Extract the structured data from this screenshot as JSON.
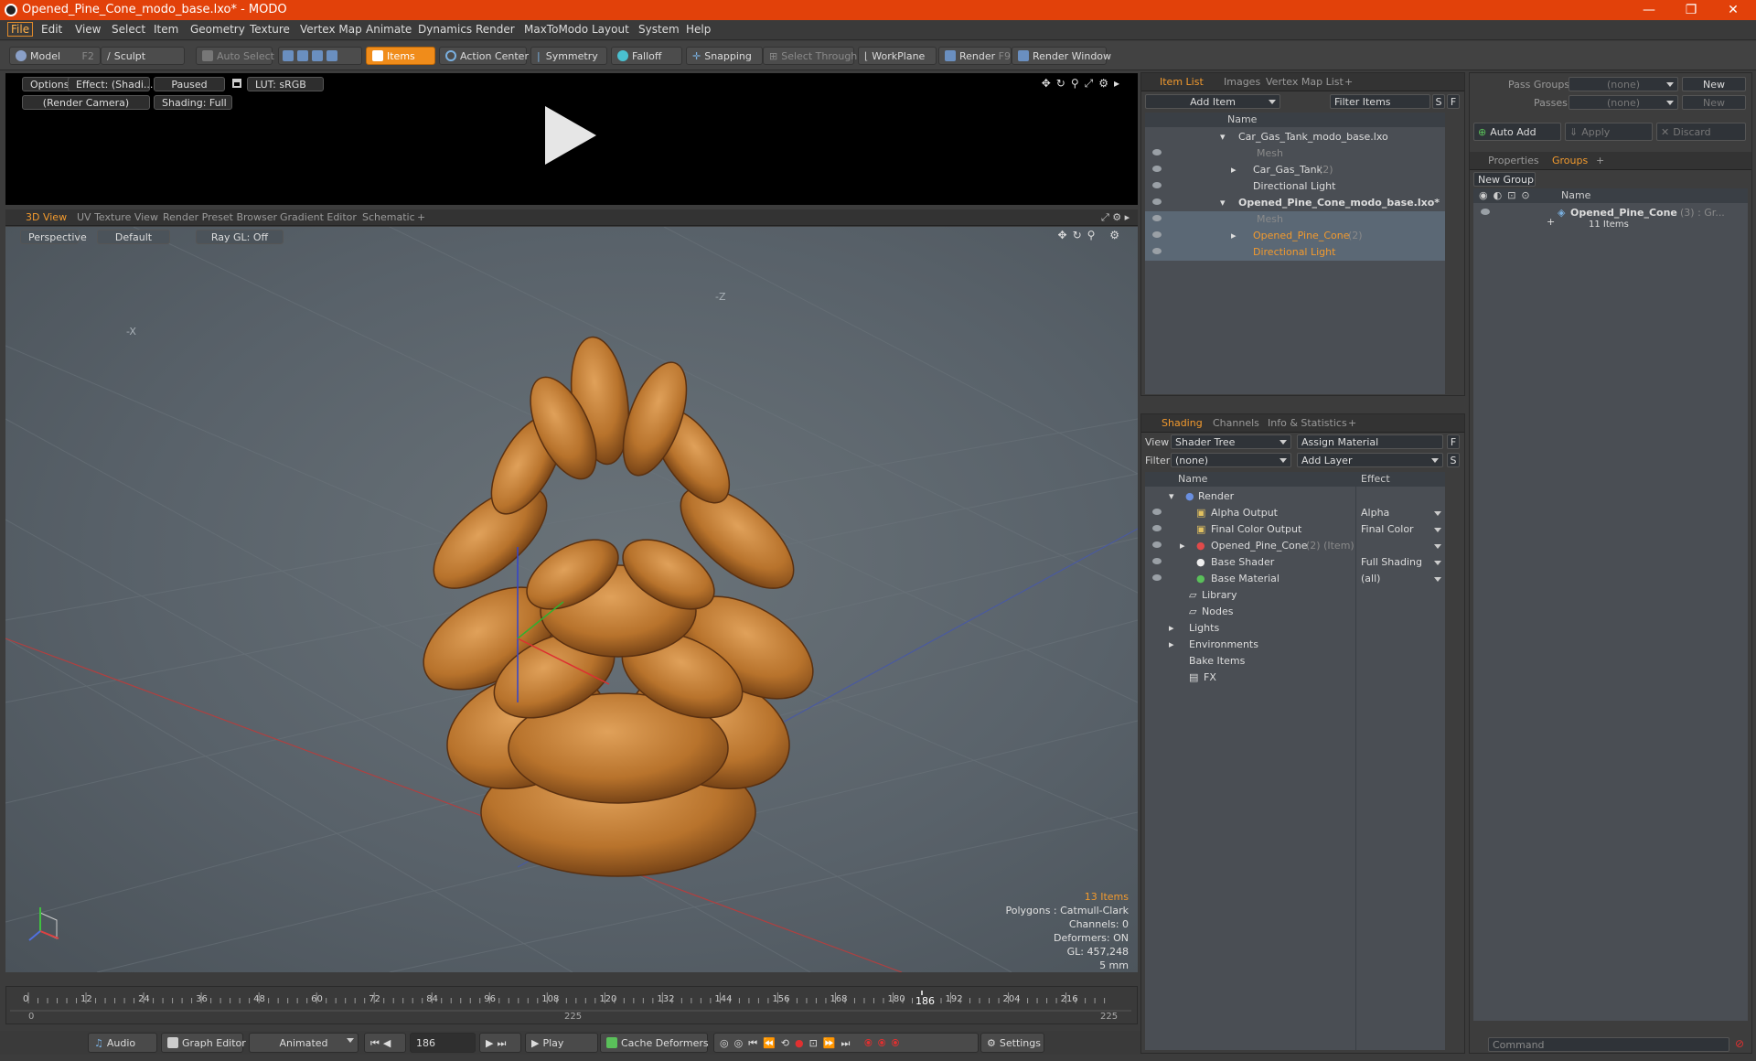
{
  "window": {
    "title": "Opened_Pine_Cone_modo_base.lxo* - MODO",
    "min": "—",
    "max": "❐",
    "close": "✕"
  },
  "menu": [
    "File",
    "Edit",
    "View",
    "Select",
    "Item",
    "Geometry",
    "Texture",
    "Vertex Map",
    "Animate",
    "Dynamics",
    "Render",
    "MaxToModo",
    "Layout",
    "System",
    "Help"
  ],
  "toolbar": {
    "model": "Model",
    "model_key": "F2",
    "sculpt": "Sculpt",
    "auto_select": "Auto Select",
    "items": "Items",
    "action_center": "Action Center",
    "symmetry": "Symmetry",
    "falloff": "Falloff",
    "snapping": "Snapping",
    "select_through": "Select Through",
    "workplane": "WorkPlane",
    "render": "Render",
    "render_key": "F9",
    "render_window": "Render Window"
  },
  "preview": {
    "options": "Options",
    "effect": "Effect: (Shadi...",
    "paused": "Paused",
    "lut": "LUT: sRGB",
    "camera": "(Render Camera)",
    "shading": "Shading: Full"
  },
  "viewtabs": [
    "3D View",
    "UV Texture View",
    "Render Preset Browser",
    "Gradient Editor",
    "Schematic",
    "+"
  ],
  "view": {
    "perspective": "Perspective",
    "default": "Default",
    "raygl": "Ray GL: Off",
    "axis_x": "-X",
    "axis_z": "-Z"
  },
  "hud": {
    "items": "13 Items",
    "polygons": "Polygons : Catmull-Clark",
    "channels": "Channels: 0",
    "deformers": "Deformers: ON",
    "gl": "GL: 457,248",
    "scale": "5 mm"
  },
  "timeline": {
    "ticks": [
      "0",
      "12",
      "24",
      "36",
      "48",
      "60",
      "72",
      "84",
      "96",
      "108",
      "120",
      "132",
      "144",
      "156",
      "168",
      "180",
      "192",
      "204",
      "216"
    ],
    "current": "186",
    "start": "0",
    "mid": "225",
    "end": "225"
  },
  "bottom": {
    "audio": "Audio",
    "graph_editor": "Graph Editor",
    "animated": "Animated",
    "frame": "186",
    "play": "Play",
    "cache": "Cache Deformers",
    "settings": "Settings"
  },
  "itemlist": {
    "tabs": [
      "Item List",
      "Images",
      "Vertex Map List",
      "+"
    ],
    "add_item": "Add Item",
    "filter": "Filter Items",
    "s": "S",
    "f": "F",
    "col_name": "Name",
    "rows": [
      {
        "label": "Car_Gas_Tank_modo_base.lxo",
        "sub": ""
      },
      {
        "label": "Mesh",
        "sub": ""
      },
      {
        "label": "Car_Gas_Tank",
        "sub": "(2)"
      },
      {
        "label": "Directional Light",
        "sub": ""
      },
      {
        "label": "Opened_Pine_Cone_modo_base.lxo*",
        "sub": ""
      },
      {
        "label": "Mesh",
        "sub": ""
      },
      {
        "label": "Opened_Pine_Cone",
        "sub": "(2)"
      },
      {
        "label": "Directional Light",
        "sub": ""
      }
    ]
  },
  "shading": {
    "tabs": [
      "Shading",
      "Channels",
      "Info & Statistics",
      "+"
    ],
    "view_label": "View",
    "view_value": "Shader Tree",
    "assign": "Assign Material",
    "f": "F",
    "filter_label": "Filter",
    "filter_value": "(none)",
    "add_layer": "Add Layer",
    "s": "S",
    "col_name": "Name",
    "col_effect": "Effect",
    "rows": [
      {
        "label": "Render",
        "effect": ""
      },
      {
        "label": "Alpha Output",
        "effect": "Alpha"
      },
      {
        "label": "Final Color Output",
        "effect": "Final Color"
      },
      {
        "label": "Opened_Pine_Cone",
        "sub": "(2) (Item)",
        "effect": ""
      },
      {
        "label": "Base Shader",
        "effect": "Full Shading"
      },
      {
        "label": "Base Material",
        "effect": "(all)"
      },
      {
        "label": "Library",
        "effect": ""
      },
      {
        "label": "Nodes",
        "effect": ""
      },
      {
        "label": "Lights",
        "effect": ""
      },
      {
        "label": "Environments",
        "effect": ""
      },
      {
        "label": "Bake Items",
        "effect": ""
      },
      {
        "label": "FX",
        "effect": ""
      }
    ]
  },
  "groups": {
    "pass_groups": "Pass Groups",
    "passes": "Passes",
    "none": "(none)",
    "new": "New",
    "auto_add": "Auto Add",
    "apply": "Apply",
    "discard": "Discard",
    "tabs": [
      "Properties",
      "Groups",
      "+"
    ],
    "new_group": "New Group",
    "col_name": "Name",
    "group_name": "Opened_Pine_Cone",
    "group_sub": "(3) : Gr...",
    "group_items": "11 Items",
    "command": "Command"
  },
  "colors": {
    "accent": "#f29a2e",
    "titlebar": "#e2410a",
    "cone": "#c07a2e"
  }
}
